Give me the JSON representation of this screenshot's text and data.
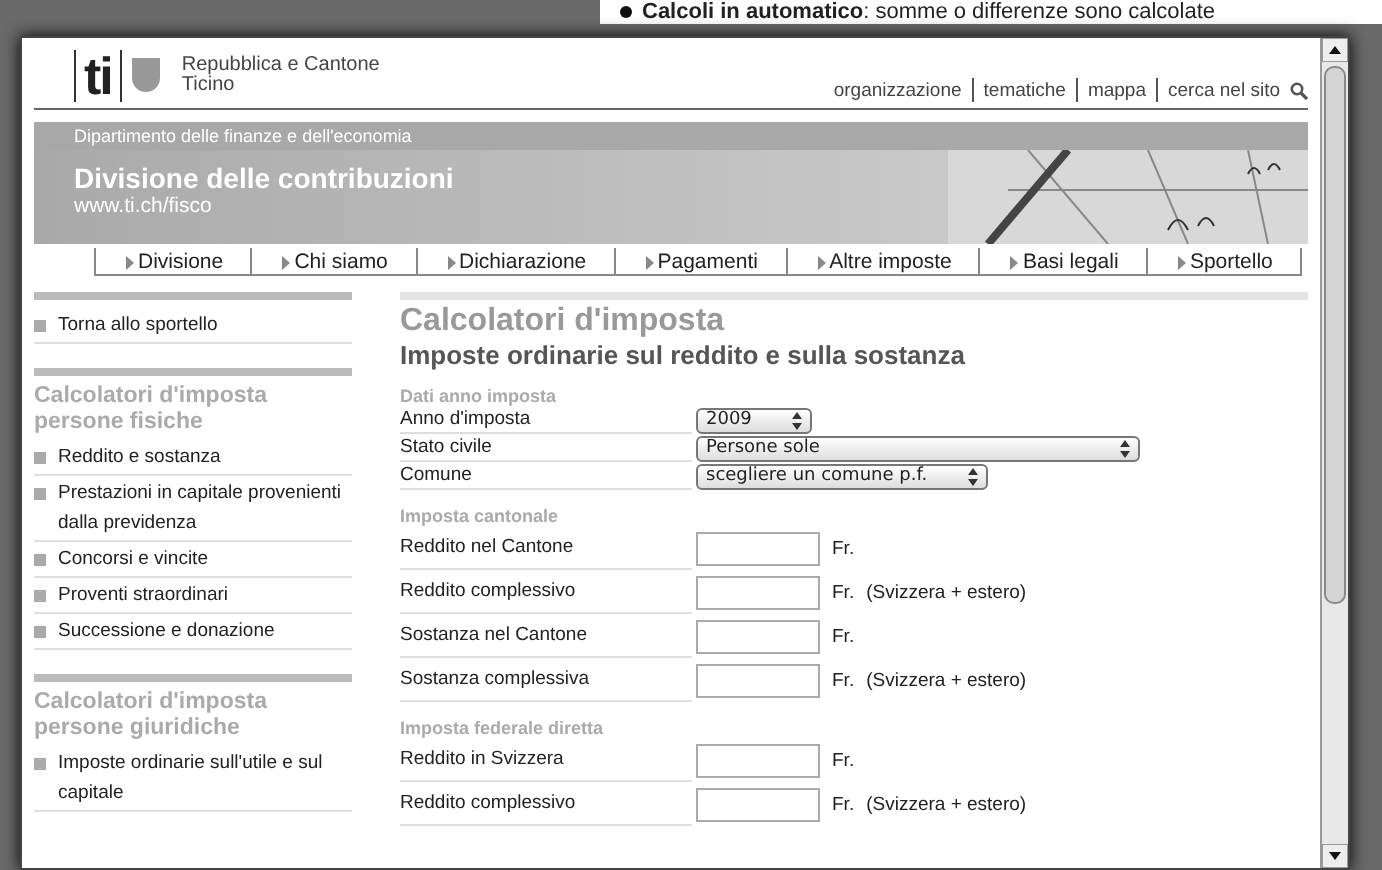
{
  "background_document": {
    "bullet_text": "**Calcoli in automatico**: somme o differenze sono calcolate"
  },
  "header": {
    "logo_text": "ti",
    "org_name": "Repubblica e Cantone",
    "org_sub": "Ticino",
    "links": [
      "organizzazione",
      "tematiche",
      "mappa",
      "cerca nel sito"
    ]
  },
  "department": "Dipartimento delle finanze e dell'economia",
  "banner": {
    "title": "Divisione delle contribuzioni",
    "url": "www.ti.ch/fisco"
  },
  "nav": [
    "Divisione",
    "Chi siamo",
    "Dichiarazione",
    "Pagamenti",
    "Altre imposte",
    "Basi legali",
    "Sportello"
  ],
  "sidebar": {
    "back_link": "Torna allo sportello",
    "sections": [
      {
        "title": "Calcolatori d'imposta persone fisiche",
        "items": [
          "Reddito e sostanza",
          "Prestazioni in capitale provenienti dalla previdenza",
          "Concorsi e vincite",
          "Proventi straordinari",
          "Successione e donazione"
        ]
      },
      {
        "title": "Calcolatori d'imposta persone giuridiche",
        "items": [
          "Imposte ordinarie sull'utile e sul capitale"
        ]
      }
    ]
  },
  "content": {
    "title": "Calcolatori d'imposta",
    "subtitle": "Imposte ordinarie sul reddito e sulla sostanza",
    "groups": [
      {
        "heading": "Dati anno imposta",
        "rows": [
          {
            "kind": "select",
            "label": "Anno d'imposta",
            "value": "2009"
          },
          {
            "kind": "select",
            "label": "Stato civile",
            "value": "Persone sole"
          },
          {
            "kind": "select",
            "label": "Comune",
            "value": "scegliere un comune p.f."
          }
        ]
      },
      {
        "heading": "Imposta cantonale",
        "rows": [
          {
            "kind": "amount",
            "label": "Reddito nel Cantone",
            "unit": "Fr."
          },
          {
            "kind": "amount",
            "label": "Reddito complessivo",
            "unit": "Fr.",
            "note": "(Svizzera + estero)"
          },
          {
            "kind": "amount",
            "label": "Sostanza nel Cantone",
            "unit": "Fr."
          },
          {
            "kind": "amount",
            "label": "Sostanza complessiva",
            "unit": "Fr.",
            "note": "(Svizzera + estero)"
          }
        ]
      },
      {
        "heading": "Imposta federale diretta",
        "rows": [
          {
            "kind": "amount",
            "label": "Reddito in Svizzera",
            "unit": "Fr."
          },
          {
            "kind": "amount",
            "label": "Reddito complessivo",
            "unit": "Fr.",
            "note": "(Svizzera + estero)"
          }
        ]
      }
    ]
  }
}
